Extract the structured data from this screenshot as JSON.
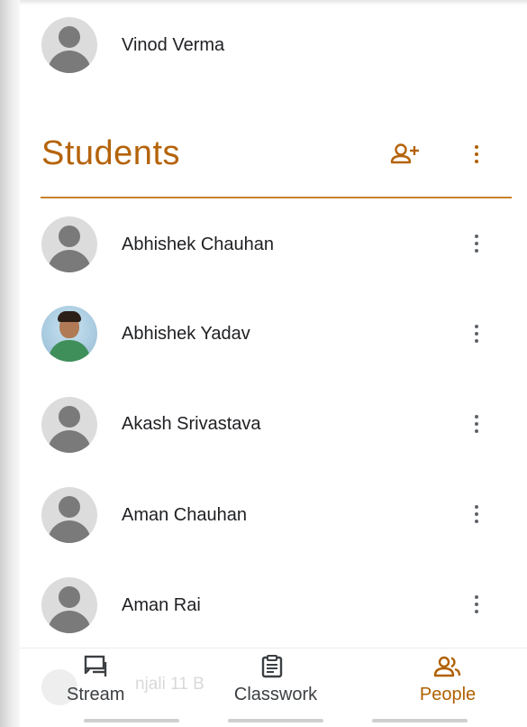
{
  "teacher": {
    "name": "Vinod Verma"
  },
  "students_section": {
    "title": "Students",
    "add_icon": "person-add-icon",
    "menu_icon": "more-vert-icon"
  },
  "students": [
    {
      "name": "Abhishek Chauhan",
      "avatar": "default-avatar-icon"
    },
    {
      "name": "Abhishek Yadav",
      "avatar": "profile-photo"
    },
    {
      "name": "Akash Srivastava",
      "avatar": "default-avatar-icon"
    },
    {
      "name": "Aman Chauhan",
      "avatar": "default-avatar-icon"
    },
    {
      "name": "Aman Rai",
      "avatar": "default-avatar-icon"
    }
  ],
  "obscured_row": {
    "text": "njali 11 B"
  },
  "bottom_nav": {
    "items": [
      {
        "label": "Stream",
        "icon": "stream-icon",
        "active": false
      },
      {
        "label": "Classwork",
        "icon": "classwork-icon",
        "active": false
      },
      {
        "label": "People",
        "icon": "people-icon",
        "active": true
      }
    ]
  },
  "colors": {
    "accent": "#b5630a",
    "rule": "#c9822a",
    "text": "#202124",
    "icon": "#5f6368"
  }
}
